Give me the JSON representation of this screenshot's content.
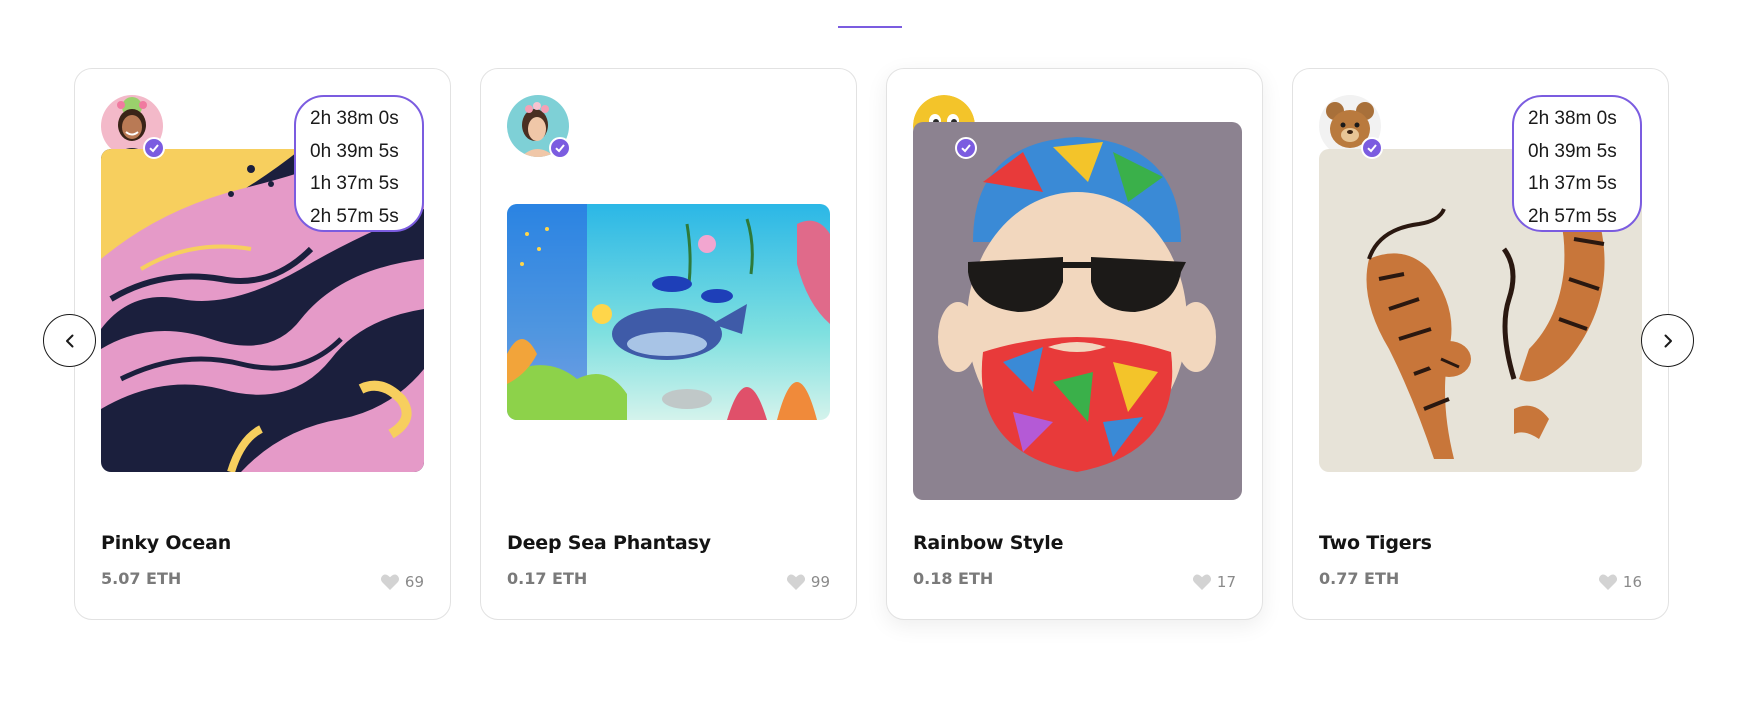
{
  "accent_color": "#7b5ce0",
  "carousel": {
    "prev_icon": "chevron-left-icon",
    "next_icon": "chevron-right-icon",
    "cards": [
      {
        "title": "Pinky Ocean",
        "price": "5.07 ETH",
        "likes": "69",
        "has_countdown": true,
        "countdown": [
          "2h 38m 0s",
          "0h 39m 5s",
          "1h 37m 5s",
          "2h 57m 5s"
        ]
      },
      {
        "title": "Deep Sea Phantasy",
        "price": "0.17 ETH",
        "likes": "99",
        "has_countdown": false
      },
      {
        "title": "Rainbow Style",
        "price": "0.18 ETH",
        "likes": "17",
        "has_countdown": false
      },
      {
        "title": "Two Tigers",
        "price": "0.77 ETH",
        "likes": "16",
        "has_countdown": true,
        "countdown": [
          "2h 38m 0s",
          "0h 39m 5s",
          "1h 37m 5s",
          "2h 57m 5s"
        ]
      }
    ]
  }
}
